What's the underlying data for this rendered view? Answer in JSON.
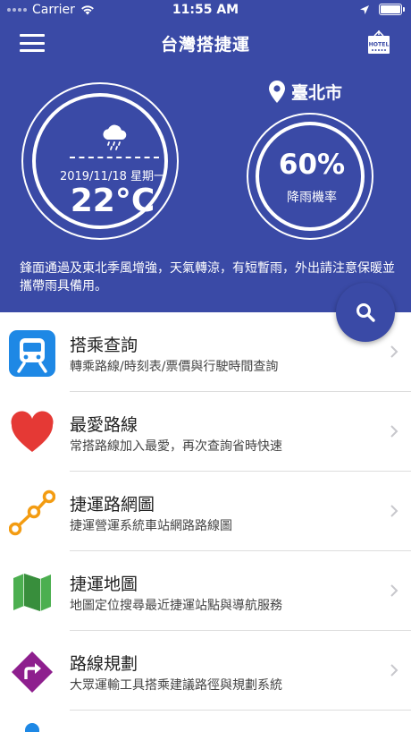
{
  "status_bar": {
    "carrier": "Carrier",
    "time": "11:55 AM"
  },
  "nav": {
    "title": "台灣搭捷運",
    "hotel_badge": "HOTEL"
  },
  "weather": {
    "date": "2019/11/18 星期一",
    "temperature": "22°C",
    "location": "臺北市",
    "rain_probability": "60%",
    "rain_label": "降雨機率",
    "forecast": "鋒面通過及東北季風增強，天氣轉涼，有短暫雨，外出請注意保暖並攜帶雨具備用。"
  },
  "menu": {
    "items": [
      {
        "title": "搭乘查詢",
        "subtitle": "轉乘路線/時刻表/票價與行駛時間查詢",
        "icon": "train-icon"
      },
      {
        "title": "最愛路線",
        "subtitle": "常搭路線加入最愛，再次查詢省時快速",
        "icon": "heart-icon"
      },
      {
        "title": "捷運路網圖",
        "subtitle": "捷運營運系統車站網路路線圖",
        "icon": "network-icon"
      },
      {
        "title": "捷運地圖",
        "subtitle": "地圖定位搜尋最近捷運站點與導航服務",
        "icon": "map-icon"
      },
      {
        "title": "路線規劃",
        "subtitle": "大眾運輸工具搭乘建議路徑與規劃系統",
        "icon": "directions-icon"
      }
    ]
  },
  "colors": {
    "primary": "#3a4aa6",
    "train_blue": "#1e88e5",
    "heart_red": "#e53935",
    "network_orange": "#f39c12",
    "map_green": "#4caf50",
    "directions_purple": "#8e1f8e"
  }
}
